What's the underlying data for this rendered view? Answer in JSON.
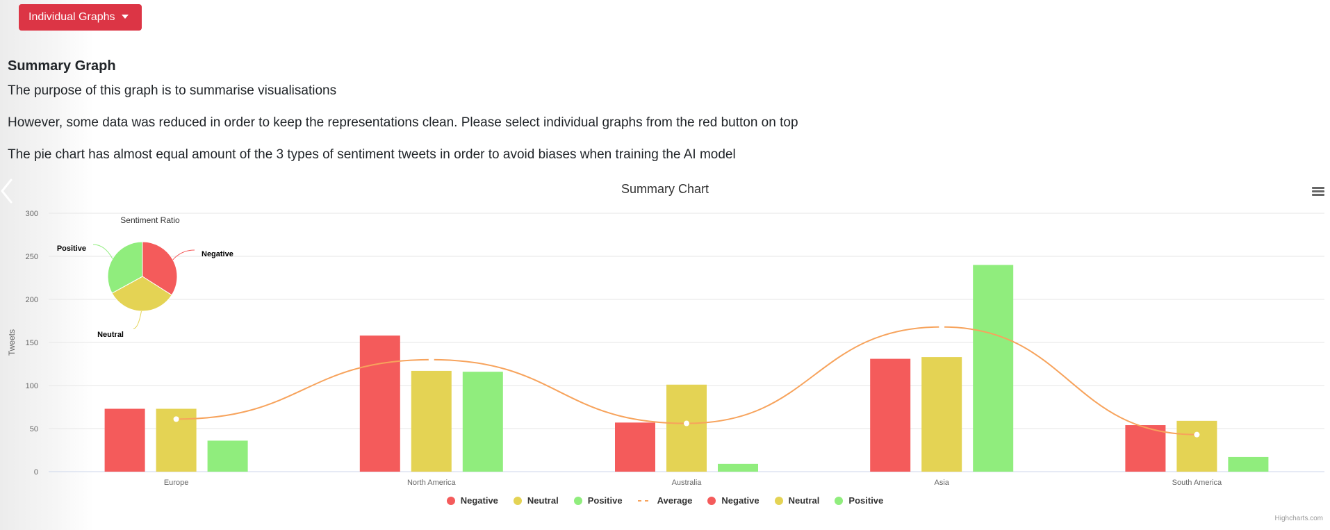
{
  "nav": {
    "dropdown_label": "Individual Graphs"
  },
  "content": {
    "heading": "Summary Graph",
    "paragraphs": [
      "The purpose of this graph is to summarise visualisations",
      "However, some data was reduced in order to keep the representations clean. Please select individual graphs from the red button on top",
      "The pie chart has almost equal amount of the 3 types of sentiment tweets in order to avoid biases when training the AI model"
    ]
  },
  "chart_data": {
    "type": "bar",
    "title": "Summary Chart",
    "xlabel": "",
    "ylabel": "Tweets",
    "ylim": [
      0,
      300
    ],
    "yticks": [
      "0",
      "50",
      "100",
      "150",
      "200",
      "250",
      "300"
    ],
    "categories": [
      "Europe",
      "North America",
      "Australia",
      "Asia",
      "South America"
    ],
    "series": [
      {
        "name": "Negative",
        "type": "column",
        "color": "#f45b5b",
        "values": [
          73,
          158,
          57,
          131,
          54
        ]
      },
      {
        "name": "Neutral",
        "type": "column",
        "color": "#e4d354",
        "values": [
          73,
          117,
          101,
          133,
          59
        ]
      },
      {
        "name": "Positive",
        "type": "column",
        "color": "#90ed7d",
        "values": [
          36,
          116,
          9,
          240,
          17
        ]
      },
      {
        "name": "Average",
        "type": "spline",
        "color": "#f7a35c",
        "values": [
          61,
          130,
          56,
          168,
          43
        ]
      }
    ],
    "pie": {
      "title": "Sentiment Ratio",
      "slices": [
        {
          "name": "Negative",
          "value": 34,
          "color": "#f45b5b"
        },
        {
          "name": "Neutral",
          "value": 33,
          "color": "#e4d354"
        },
        {
          "name": "Positive",
          "value": 33,
          "color": "#90ed7d"
        }
      ]
    },
    "legend": {
      "placement": "bottom-center",
      "items": [
        {
          "name": "Negative",
          "color": "#f45b5b",
          "symbol": "circle"
        },
        {
          "name": "Neutral",
          "color": "#e4d354",
          "symbol": "circle"
        },
        {
          "name": "Positive",
          "color": "#90ed7d",
          "symbol": "circle"
        },
        {
          "name": "Average",
          "color": "#f7a35c",
          "symbol": "dashed-line"
        },
        {
          "name": "Negative",
          "color": "#f45b5b",
          "symbol": "circle"
        },
        {
          "name": "Neutral",
          "color": "#e4d354",
          "symbol": "circle"
        },
        {
          "name": "Positive",
          "color": "#90ed7d",
          "symbol": "circle"
        }
      ]
    },
    "grid": true,
    "credits": "Highcharts.com"
  },
  "icons": {
    "menu": "hamburger-menu-icon",
    "dropdown_caret": "caret-down-icon",
    "carousel_prev": "chevron-left-icon"
  }
}
